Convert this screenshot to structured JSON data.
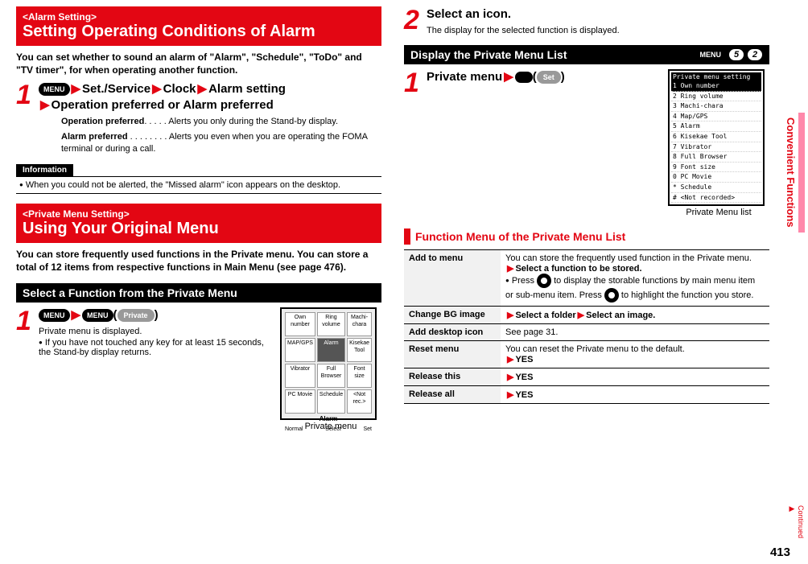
{
  "left": {
    "alarm": {
      "tag": "<Alarm Setting>",
      "title": "Setting Operating Conditions of Alarm",
      "intro": "You can set whether to sound an alarm of \"Alarm\", \"Schedule\", \"ToDo\" and \"TV timer\", for when operating another function.",
      "step": {
        "num": "1",
        "menu_key": "MENU",
        "line1a": "Set./Service",
        "line1b": "Clock",
        "line1c": "Alarm setting",
        "line2": "Operation preferred or Alarm preferred"
      },
      "defs": [
        {
          "label": "Operation preferred",
          "dots": ". . . . .",
          "desc": "Alerts you only during the Stand-by display."
        },
        {
          "label": "Alarm preferred",
          "dots": " . . . . . . . .",
          "desc": "Alerts you even when you are operating the FOMA terminal or during a call."
        }
      ],
      "info_label": "Information",
      "info_text": "When you could not be alerted, the \"Missed alarm\" icon appears on the desktop."
    },
    "private": {
      "tag": "<Private Menu Setting>",
      "title": "Using Your Original Menu",
      "intro": "You can store frequently used functions in the Private menu. You can store a total of 12 items from respective functions in Main Menu (see page 476).",
      "bar": "Select a Function from the Private Menu",
      "step": {
        "num": "1",
        "key1": "MENU",
        "key2": "MENU",
        "btn": "Private",
        "body1": "Private menu is displayed.",
        "body2": "If you have not touched any key for at least 15 seconds, the Stand-by display returns."
      },
      "screenshot": {
        "grid": [
          "Own number",
          "Ring volume",
          "Machi-chara",
          "MAP/GPS",
          "Alarm",
          "Kisekae Tool",
          "Vibrator",
          "Full Browser",
          "Font size",
          "PC Movie",
          "Schedule",
          "<Not rec.>"
        ],
        "selected_index": 4,
        "title_bar": "Alarm",
        "footer": [
          "Normal",
          "Select",
          "Set"
        ],
        "caption": "Private menu"
      }
    }
  },
  "right": {
    "step2": {
      "num": "2",
      "title": "Select an icon.",
      "body": "The display for the selected function is displayed."
    },
    "display_bar": "Display the Private Menu List",
    "header_keys": {
      "k1": "MENU",
      "k2": "5",
      "k3": "2"
    },
    "step1": {
      "num": "1",
      "title_a": "Private menu",
      "btn": "Set"
    },
    "screenshot": {
      "hdr": "Private menu setting",
      "rows": [
        "1 Own number",
        "2 Ring volume",
        "3 Machi-chara",
        "4 Map/GPS",
        "5 Alarm",
        "6 Kisekae Tool",
        "7 Vibrator",
        "8 Full Browser",
        "9 Font size",
        "0 PC Movie",
        "* Schedule",
        "# <Not recorded>"
      ],
      "selected_index": 0,
      "caption": "Private Menu list"
    },
    "func_bar": "Function Menu of the Private Menu List",
    "table": [
      {
        "k": "Add to menu",
        "v": "You can store the frequently used function in the Private menu.",
        "v2": "Select a function to be stored.",
        "v3": "Press",
        "v3b": " to display the storable functions by main menu item or sub-menu item. Press ",
        "v3c": " to highlight the function you store."
      },
      {
        "k": "Change BG image",
        "v2": "Select a folder",
        "v2b": "Select an image."
      },
      {
        "k": "Add desktop icon",
        "v": "See page 31."
      },
      {
        "k": "Reset menu",
        "v": "You can reset the Private menu to the default.",
        "v2": "YES"
      },
      {
        "k": "Release this",
        "v2": "YES"
      },
      {
        "k": "Release all",
        "v2": "YES"
      }
    ]
  },
  "side_tab": "Convenient Functions",
  "continued": "Continued",
  "page_num": "413"
}
